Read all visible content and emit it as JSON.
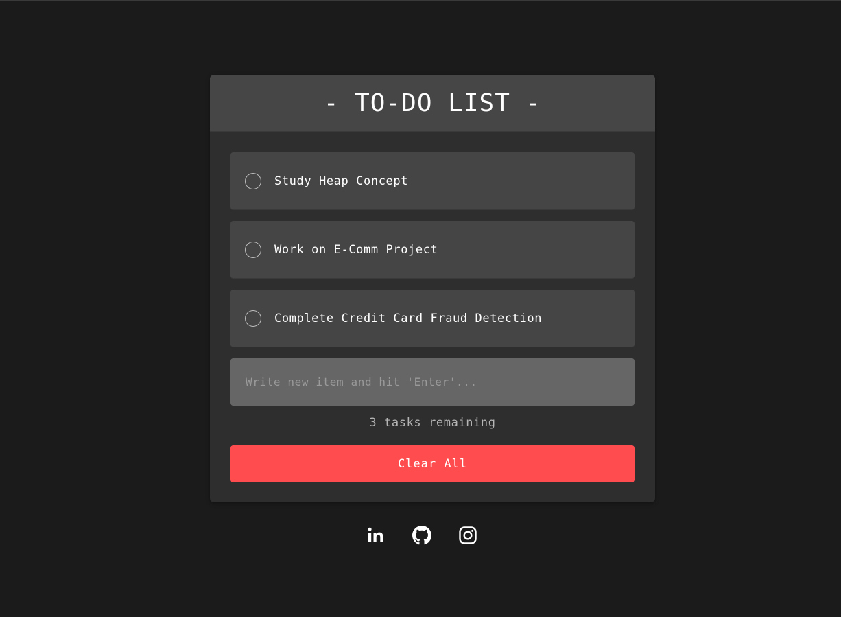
{
  "header": {
    "title": "- TO-DO LIST -"
  },
  "todos": [
    {
      "label": "Study Heap Concept",
      "done": false
    },
    {
      "label": "Work on E-Comm Project",
      "done": false
    },
    {
      "label": "Complete Credit Card Fraud Detection",
      "done": false
    }
  ],
  "input": {
    "placeholder": "Write new item and hit 'Enter'...",
    "value": ""
  },
  "status": {
    "remaining_text": "3 tasks remaining"
  },
  "actions": {
    "clear_label": "Clear All"
  },
  "social": [
    {
      "icon": "linkedin-icon"
    },
    {
      "icon": "github-icon"
    },
    {
      "icon": "instagram-icon"
    }
  ],
  "colors": {
    "background": "#1b1b1b",
    "card": "#2e2e2f",
    "header": "#464646",
    "item": "#454545",
    "input": "#666666",
    "accent": "#ff4d4f"
  }
}
